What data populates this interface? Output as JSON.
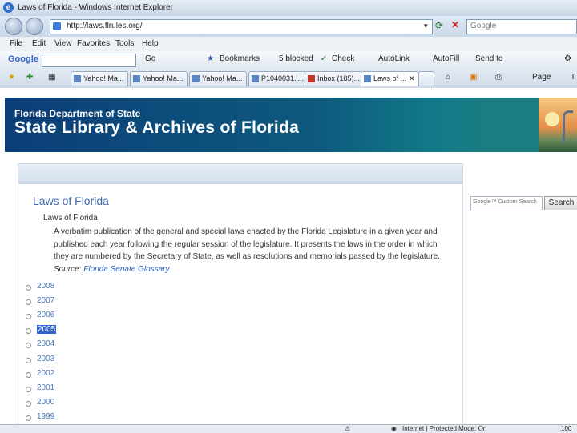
{
  "window": {
    "title": "Laws of Florida - Windows Internet Explorer"
  },
  "address": {
    "url": "http://laws.flrules.org/",
    "search_placeholder": "Google"
  },
  "menu": [
    "File",
    "Edit",
    "View",
    "Favorites",
    "Tools",
    "Help"
  ],
  "google_toolbar": {
    "logo": "Google",
    "go": "Go",
    "bookmarks": "Bookmarks",
    "blocked": "5 blocked",
    "check": "Check",
    "autolink": "AutoLink",
    "autofill": "AutoFill",
    "sendto": "Send to"
  },
  "tabs": [
    {
      "label": "Yahoo! Ma..."
    },
    {
      "label": "Yahoo! Ma..."
    },
    {
      "label": "Yahoo! Ma..."
    },
    {
      "label": "P1040031.j..."
    },
    {
      "label": "Inbox (185)..."
    },
    {
      "label": "Laws of ..."
    }
  ],
  "command_bar": {
    "page": "Page",
    "t": "T"
  },
  "banner": {
    "line1": "Florida Department of State",
    "line2": "State Library & Archives of Florida"
  },
  "main": {
    "title": "Laws of Florida",
    "subtitle": "Laws of Florida",
    "description": "A verbatim publication of the general and special laws enacted by the Florida Legislature in a given year and published each year following the regular session of the legislature. It presents the laws in the order in which they are numbered by the Secretary of State, as well as resolutions and memorials passed by the legislature.",
    "source_label": "Source:",
    "source_link": "Florida Senate Glossary",
    "years": [
      "2008",
      "2007",
      "2006",
      "2005",
      "2004",
      "2003",
      "2002",
      "2001",
      "2000",
      "1999"
    ],
    "selected_year": "2005"
  },
  "site_search": {
    "placeholder": "Google™ Custom Search",
    "button": "Search"
  },
  "status": {
    "zone": "Internet | Protected Mode: On",
    "zoom": "100"
  }
}
